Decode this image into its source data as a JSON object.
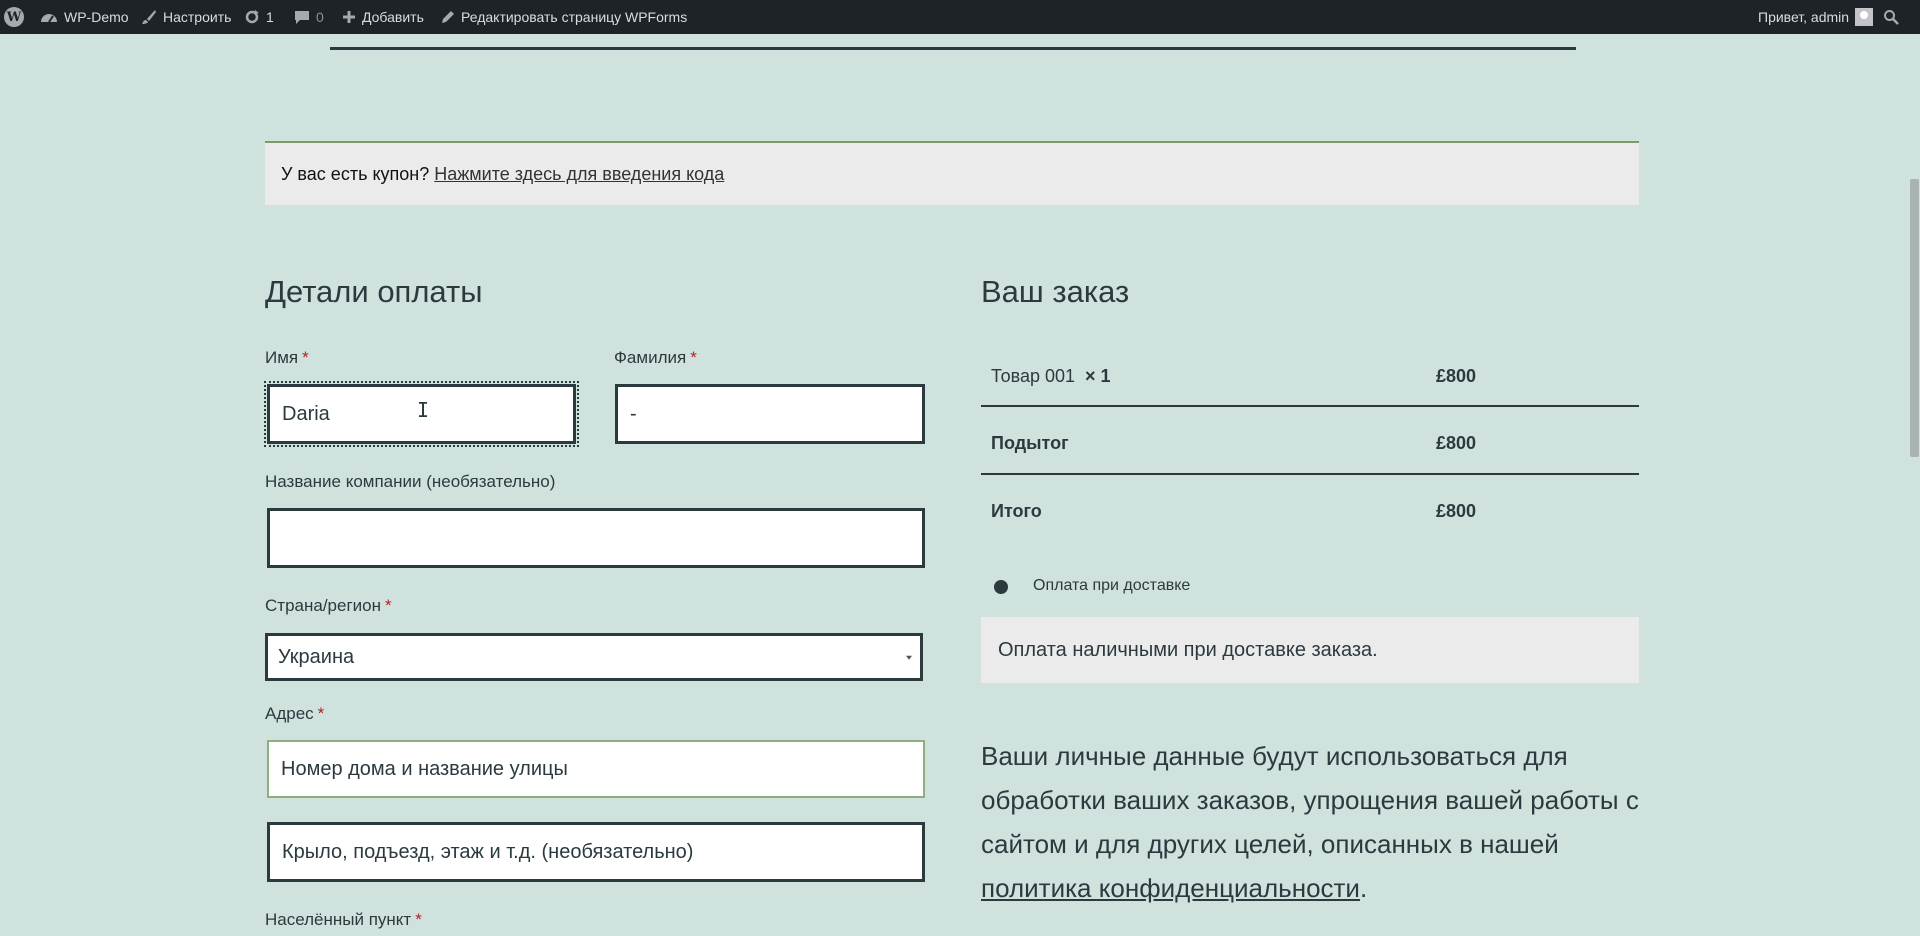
{
  "adminbar": {
    "site_name": "WP-Demo",
    "customize": "Настроить",
    "updates_count": "1",
    "comments_count": "0",
    "add_new": "Добавить",
    "edit_page": "Редактировать страницу",
    "wpforms": "WPForms",
    "greeting": "Привет, admin"
  },
  "coupon": {
    "text": "У вас есть купон?",
    "link": "Нажмите здесь для введения кода"
  },
  "billing": {
    "title": "Детали оплаты",
    "first_name": {
      "label": "Имя",
      "value": "Daria",
      "required": "*"
    },
    "last_name": {
      "label": "Фамилия",
      "value": "-",
      "required": "*"
    },
    "company": {
      "label": "Название компании (необязательно)",
      "value": ""
    },
    "country": {
      "label": "Страна/регион",
      "value": "Украина",
      "required": "*"
    },
    "address": {
      "label": "Адрес",
      "required": "*",
      "placeholder1": "Номер дома и название улицы",
      "placeholder2": "Крыло, подъезд, этаж и т.д. (необязательно)"
    },
    "city": {
      "label": "Населённый пункт",
      "required": "*"
    }
  },
  "order": {
    "title": "Ваш заказ",
    "item_name": "Товар 001",
    "item_qty": "× 1",
    "item_price": "£800",
    "subtotal_label": "Подытог",
    "subtotal_value": "£800",
    "total_label": "Итого",
    "total_value": "£800",
    "payment_method": "Оплата при доставке",
    "payment_desc": "Оплата наличными при доставке заказа.",
    "privacy_text": "Ваши личные данные будут использоваться для обработки ваших заказов, упрощения вашей работы с сайтом и для других целей, описанных в нашей",
    "privacy_link": "политика конфиденциальности",
    "privacy_end": "."
  }
}
